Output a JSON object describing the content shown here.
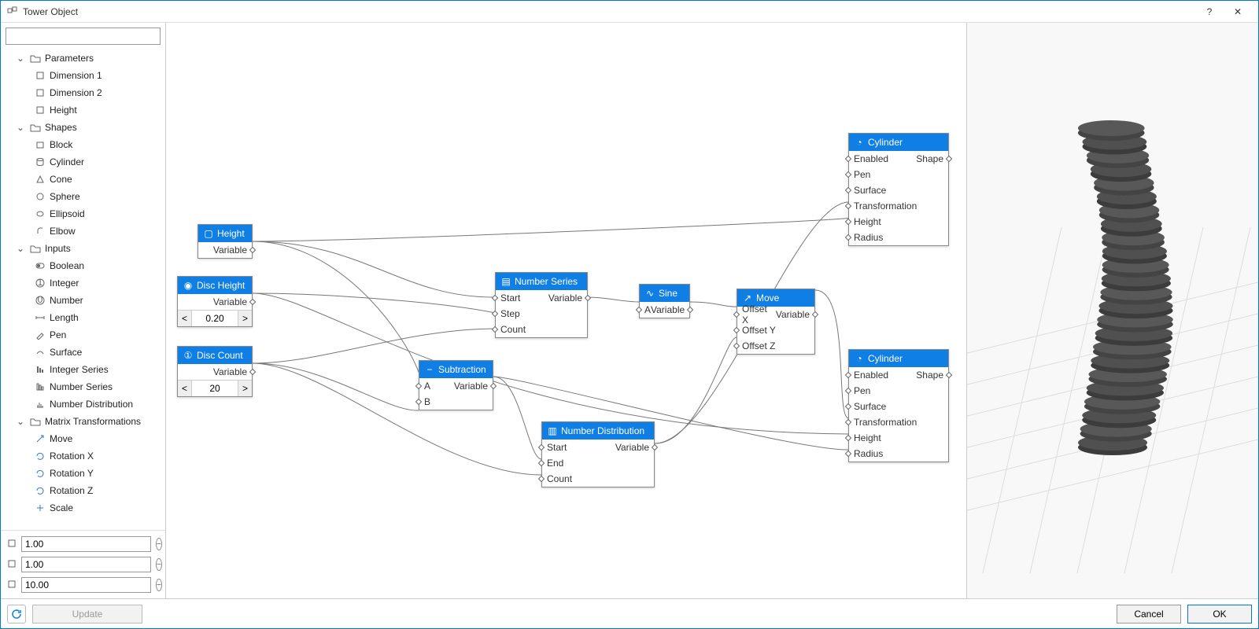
{
  "window": {
    "title": "Tower Object",
    "help": "?",
    "close": "✕"
  },
  "search_placeholder": "",
  "tree": {
    "parameters": {
      "label": "Parameters",
      "items": [
        "Dimension 1",
        "Dimension 2",
        "Height"
      ]
    },
    "shapes": {
      "label": "Shapes",
      "items": [
        "Block",
        "Cylinder",
        "Cone",
        "Sphere",
        "Ellipsoid",
        "Elbow"
      ]
    },
    "inputs": {
      "label": "Inputs",
      "items": [
        "Boolean",
        "Integer",
        "Number",
        "Length",
        "Pen",
        "Surface",
        "Integer Series",
        "Number Series",
        "Number Distribution"
      ]
    },
    "matrix": {
      "label": "Matrix Transformations",
      "items": [
        "Move",
        "Rotation X",
        "Rotation Y",
        "Rotation Z",
        "Scale"
      ]
    }
  },
  "dims": {
    "d1": "1.00",
    "d2": "1.00",
    "height": "10.00"
  },
  "nodes": {
    "height": {
      "title": "Height",
      "out": "Variable"
    },
    "disc_height": {
      "title": "Disc Height",
      "out": "Variable",
      "value": "0.20"
    },
    "disc_count": {
      "title": "Disc Count",
      "out": "Variable",
      "value": "20"
    },
    "subtraction": {
      "title": "Subtraction",
      "a": "A",
      "b": "B",
      "out": "Variable"
    },
    "number_series": {
      "title": "Number Series",
      "start": "Start",
      "step": "Step",
      "count": "Count",
      "out": "Variable"
    },
    "sine": {
      "title": "Sine",
      "a": "A",
      "out": "Variable"
    },
    "number_dist": {
      "title": "Number Distribution",
      "start": "Start",
      "end": "End",
      "count": "Count",
      "out": "Variable"
    },
    "move": {
      "title": "Move",
      "ox": "Offset X",
      "oy": "Offset Y",
      "oz": "Offset Z",
      "out": "Variable"
    },
    "cyl1": {
      "title": "Cylinder",
      "enabled": "Enabled",
      "pen": "Pen",
      "surface": "Surface",
      "transform": "Transformation",
      "height": "Height",
      "radius": "Radius",
      "out": "Shape"
    },
    "cyl2": {
      "title": "Cylinder",
      "enabled": "Enabled",
      "pen": "Pen",
      "surface": "Surface",
      "transform": "Transformation",
      "height": "Height",
      "radius": "Radius",
      "out": "Shape"
    }
  },
  "footer": {
    "update": "Update",
    "cancel": "Cancel",
    "ok": "OK"
  }
}
